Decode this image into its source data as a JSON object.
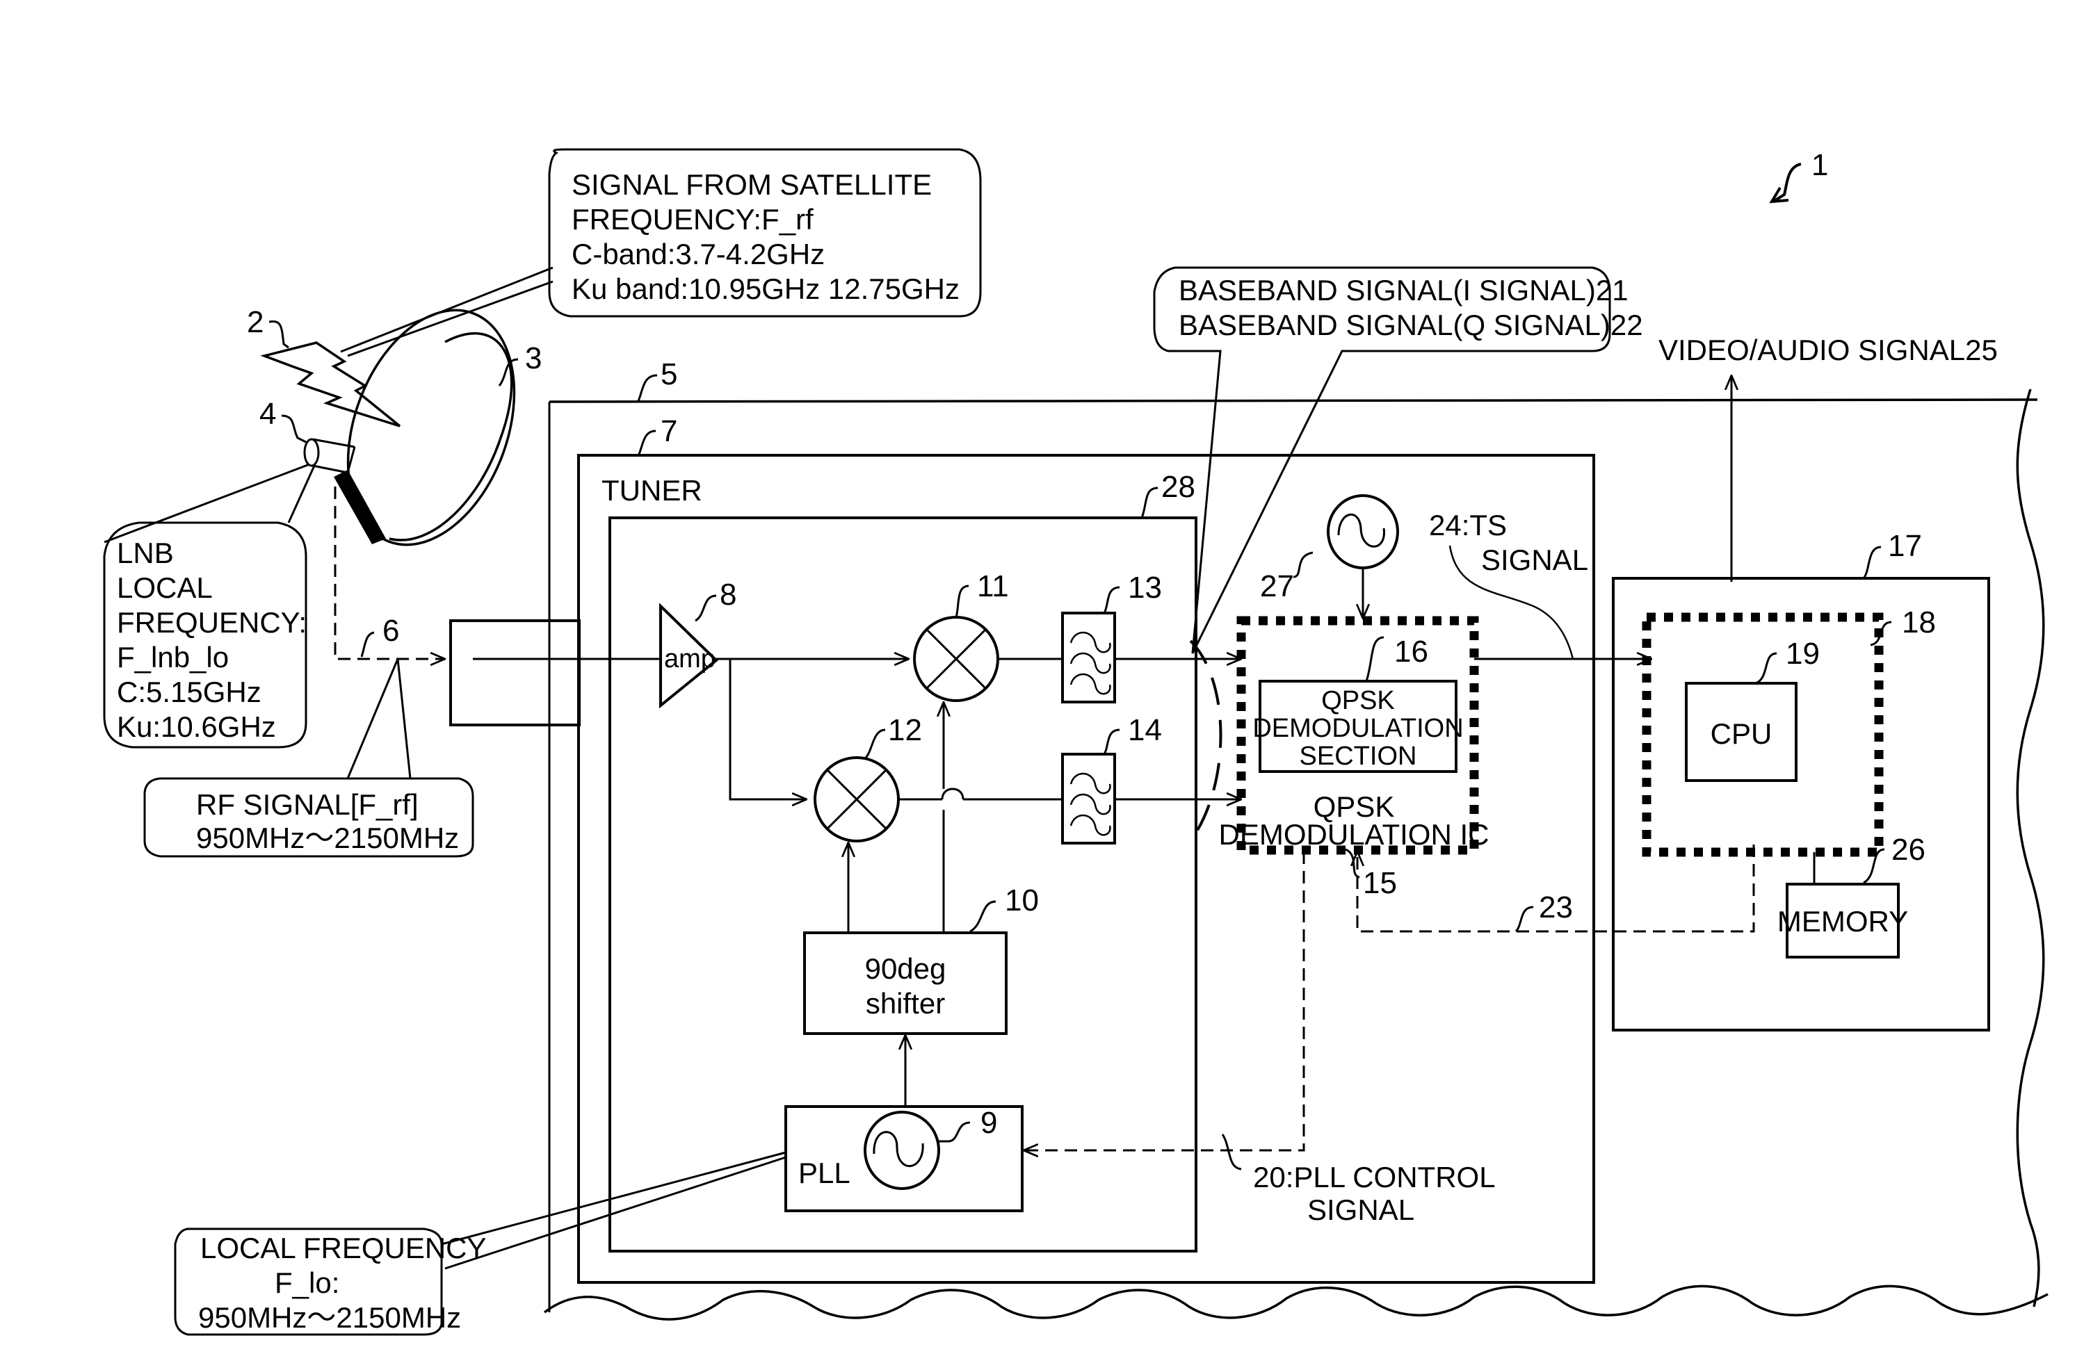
{
  "figure": {
    "ref_main": "1",
    "refs": {
      "satellite_signal": "2",
      "dish": "3",
      "lnb": "4",
      "receiver": "5",
      "rf_cable": "6",
      "tuner_box": "7",
      "amp": "8",
      "oscillator_pll": "9",
      "shifter": "10",
      "mixer_i": "11",
      "mixer_q": "12",
      "filter_i": "13",
      "filter_q": "14",
      "demod_ic": "15",
      "demod_section": "16",
      "board": "17",
      "cpu_block": "18",
      "cpu": "19",
      "bus_23": "23",
      "memory": "26",
      "crystal": "27",
      "tuner_inner": "28"
    }
  },
  "callouts": {
    "satellite": [
      "SIGNAL FROM SATELLITE",
      "FREQUENCY:F_rf",
      "C-band:3.7-4.2GHz",
      "Ku band:10.95GHz 12.75GHz"
    ],
    "lnb": [
      "LNB",
      "LOCAL",
      "FREQUENCY:",
      "F_lnb_lo",
      "C:5.15GHz",
      "Ku:10.6GHz"
    ],
    "rf_signal": [
      "RF SIGNAL[F_rf]",
      "950MHz〜2150MHz"
    ],
    "local_freq": [
      "LOCAL FREQUENCY",
      "F_lo:",
      "950MHz〜2150MHz"
    ],
    "baseband": [
      "BASEBAND SIGNAL(I SIGNAL)21",
      "BASEBAND SIGNAL(Q SIGNAL)22"
    ]
  },
  "labels": {
    "tuner": "TUNER",
    "amp": "amp",
    "shifter": [
      "90deg",
      "shifter"
    ],
    "pll": "PLL",
    "demod_section": [
      "QPSK",
      "DEMODULATION",
      "SECTION"
    ],
    "demod_ic": [
      "QPSK",
      "DEMODULATION IC"
    ],
    "ts_signal": [
      "24:TS",
      "SIGNAL"
    ],
    "pll_control": [
      "20:PLL CONTROL",
      "SIGNAL"
    ],
    "video_audio": "VIDEO/AUDIO SIGNAL25",
    "cpu": "CPU",
    "memory": "MEMORY"
  }
}
